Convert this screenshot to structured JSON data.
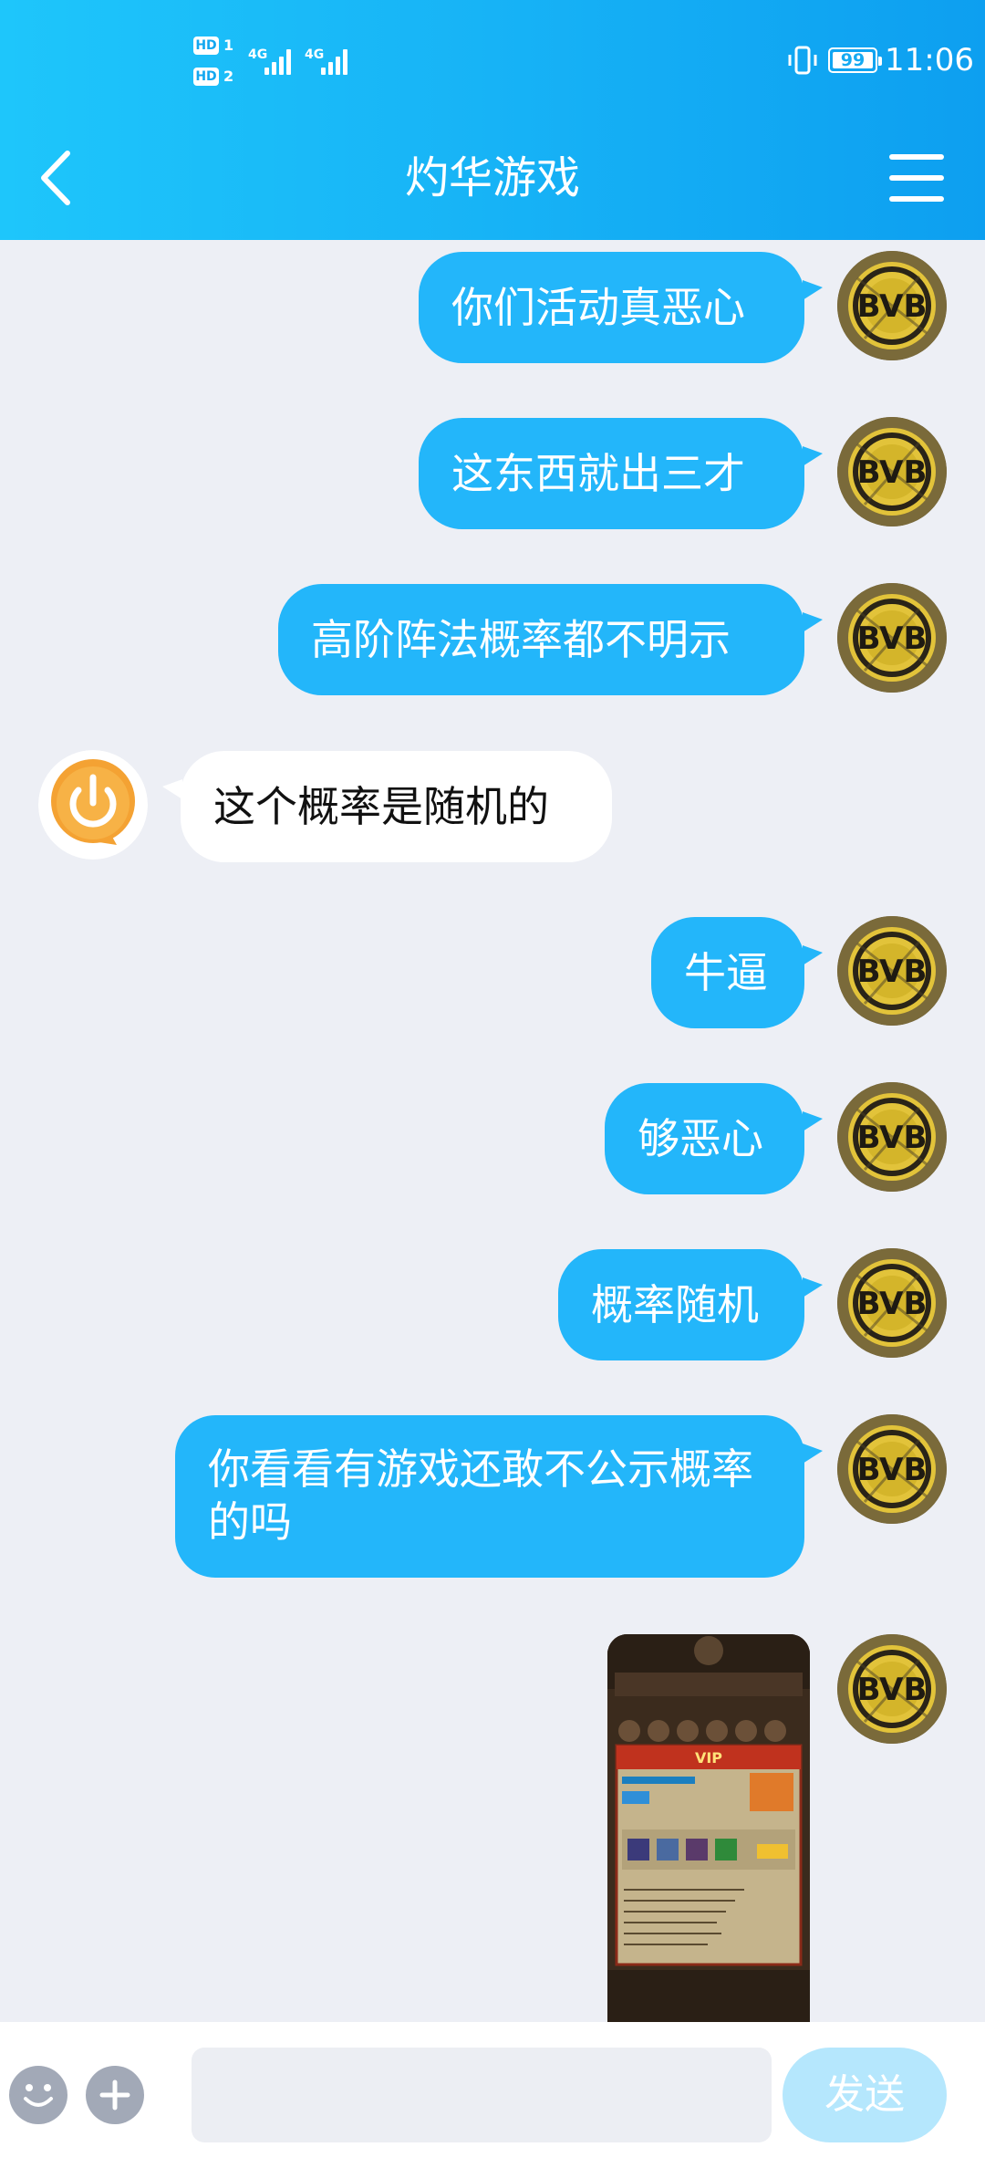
{
  "status_bar": {
    "sim1": "HD",
    "sim1_num": "1",
    "sim2": "HD",
    "sim2_num": "2",
    "net1": "4G",
    "net2": "4G",
    "battery": "99",
    "time": "11:06"
  },
  "header": {
    "title": "灼华游戏",
    "back_icon": "chevron-left-icon",
    "menu_icon": "hamburger-menu-icon"
  },
  "messages": [
    {
      "side": "out",
      "text": "你们活动真恶心"
    },
    {
      "side": "out",
      "text": "这东西就出三才"
    },
    {
      "side": "out",
      "text": "高阶阵法概率都不明示"
    },
    {
      "side": "in",
      "text": "这个概率是随机的"
    },
    {
      "side": "out",
      "text": "牛逼"
    },
    {
      "side": "out",
      "text": "够恶心"
    },
    {
      "side": "out",
      "text": "概率随机"
    },
    {
      "side": "out",
      "text": "你看看有游戏还敢不公示概率的吗"
    },
    {
      "side": "out",
      "type": "image",
      "image_label": "VIP"
    }
  ],
  "input": {
    "placeholder": "",
    "send_label": "发送",
    "emoji_icon": "smiley-icon",
    "plus_icon": "plus-icon"
  },
  "colors": {
    "header_start": "#1ec6fb",
    "header_end": "#0d9ff0",
    "outgoing_bubble": "#23b6fa",
    "incoming_bubble": "#ffffff",
    "chat_bg": "#edeff5",
    "send_disabled": "#b5e7fd"
  }
}
